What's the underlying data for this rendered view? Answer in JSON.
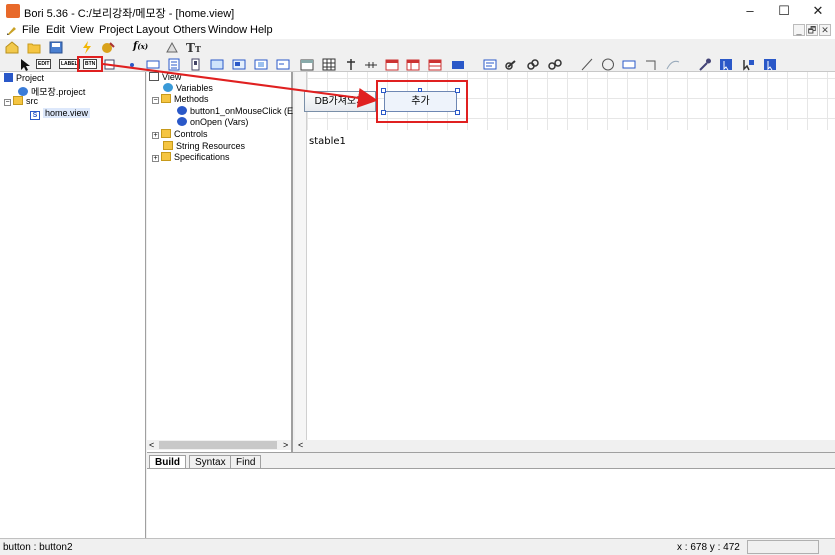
{
  "window": {
    "title": "Bori 5.36 - C:/보리강좌/메모장 - [home.view]",
    "controls": [
      "–",
      "☐",
      "✕"
    ]
  },
  "menu": [
    "File",
    "Edit",
    "View",
    "Project",
    "Layout",
    "Others",
    "Window",
    "Help"
  ],
  "mdi_controls": [
    "_",
    "🗗",
    "✕"
  ],
  "toolbar2": {
    "edit_label": "EDIT",
    "label_label": "LABEL",
    "btn_label": "BTN"
  },
  "project_tree": {
    "root": "Project",
    "project_file": "메모장.project",
    "src_folder": "src",
    "view_file": "home.view"
  },
  "view_tree": {
    "root": "View",
    "variables": "Variables",
    "methods": "Methods",
    "method1": "button1_onMouseClick (E",
    "method2": "onOpen (Vars)",
    "controls": "Controls",
    "string_resources": "String Resources",
    "specifications": "Specifications"
  },
  "designer": {
    "button1_label": "DB가져오기",
    "button2_label": "추가",
    "table_label": "stable1"
  },
  "bottom_tabs": [
    "Build",
    "Syntax",
    "Find"
  ],
  "status": {
    "selection": "button : button2",
    "coords": "x : 678  y : 472"
  },
  "colors": {
    "annotation_red": "#e02020",
    "selection_handle": "#2a58c8",
    "app_icon": "#e8692a"
  }
}
